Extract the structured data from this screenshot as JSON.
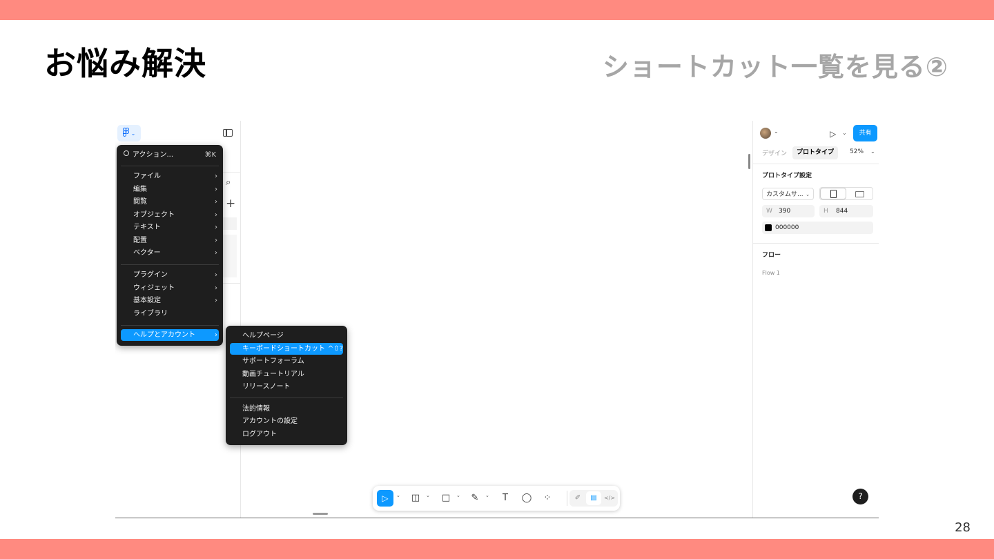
{
  "slide": {
    "title": "お悩み解決",
    "subtitle": "ショートカット一覧を見る②",
    "page_number": "28",
    "accent_color": "#ff8a80"
  },
  "left_panel": {
    "logo_icon": "figma-icon",
    "chevron": "⌄",
    "search_glyph": "⌕",
    "plus_glyph": "+"
  },
  "main_menu": {
    "search_label": "アクション...",
    "search_shortcut": "⌘K",
    "items": [
      {
        "label": "ファイル",
        "arrow": "›"
      },
      {
        "label": "編集",
        "arrow": "›"
      },
      {
        "label": "閲覧",
        "arrow": "›"
      },
      {
        "label": "オブジェクト",
        "arrow": "›"
      },
      {
        "label": "テキスト",
        "arrow": "›"
      },
      {
        "label": "配置",
        "arrow": "›"
      },
      {
        "label": "ベクター",
        "arrow": "›"
      }
    ],
    "items2": [
      {
        "label": "プラグイン",
        "arrow": "›"
      },
      {
        "label": "ウィジェット",
        "arrow": "›"
      },
      {
        "label": "基本設定",
        "arrow": "›"
      },
      {
        "label": "ライブラリ",
        "arrow": ""
      }
    ],
    "highlighted": {
      "label": "ヘルプとアカウント",
      "arrow": "›"
    }
  },
  "help_submenu": {
    "items": [
      {
        "label": "ヘルプページ"
      },
      {
        "label": "キーボードショートカット",
        "shortcut": "^⇧?"
      },
      {
        "label": "サポートフォーラム"
      },
      {
        "label": "動画チュートリアル"
      },
      {
        "label": "リリースノート"
      }
    ],
    "items2": [
      {
        "label": "法的情報"
      },
      {
        "label": "アカウントの設定"
      },
      {
        "label": "ログアウト"
      }
    ]
  },
  "right_panel": {
    "share_label": "共有",
    "play_glyph": "▷",
    "chevron": "⌄",
    "tab_design": "デザイン",
    "tab_prototype": "プロトタイプ",
    "zoom": "52%",
    "section_settings": "プロトタイプ設定",
    "device_preset": "カスタムサ...",
    "w_label": "W",
    "w_value": "390",
    "h_label": "H",
    "h_value": "844",
    "background_hex": "000000",
    "section_flow": "フロー",
    "flow_item": "Flow 1",
    "help_glyph": "?"
  },
  "toolbar": {
    "tools": [
      {
        "name": "move-tool-icon",
        "glyph": "▷",
        "selected": true
      },
      {
        "name": "frame-tool-icon",
        "glyph": "◫"
      },
      {
        "name": "rectangle-tool-icon",
        "glyph": "□"
      },
      {
        "name": "pen-tool-icon",
        "glyph": "✎"
      },
      {
        "name": "text-tool-icon",
        "glyph": "T"
      },
      {
        "name": "comment-tool-icon",
        "glyph": "◯"
      },
      {
        "name": "actions-tool-icon",
        "glyph": "⁘"
      }
    ],
    "modes": [
      {
        "name": "draw-mode-icon",
        "glyph": "✐"
      },
      {
        "name": "design-mode-icon",
        "glyph": "▤",
        "selected": true
      },
      {
        "name": "dev-mode-icon",
        "glyph": "</>"
      }
    ],
    "chevron": "⌄"
  }
}
